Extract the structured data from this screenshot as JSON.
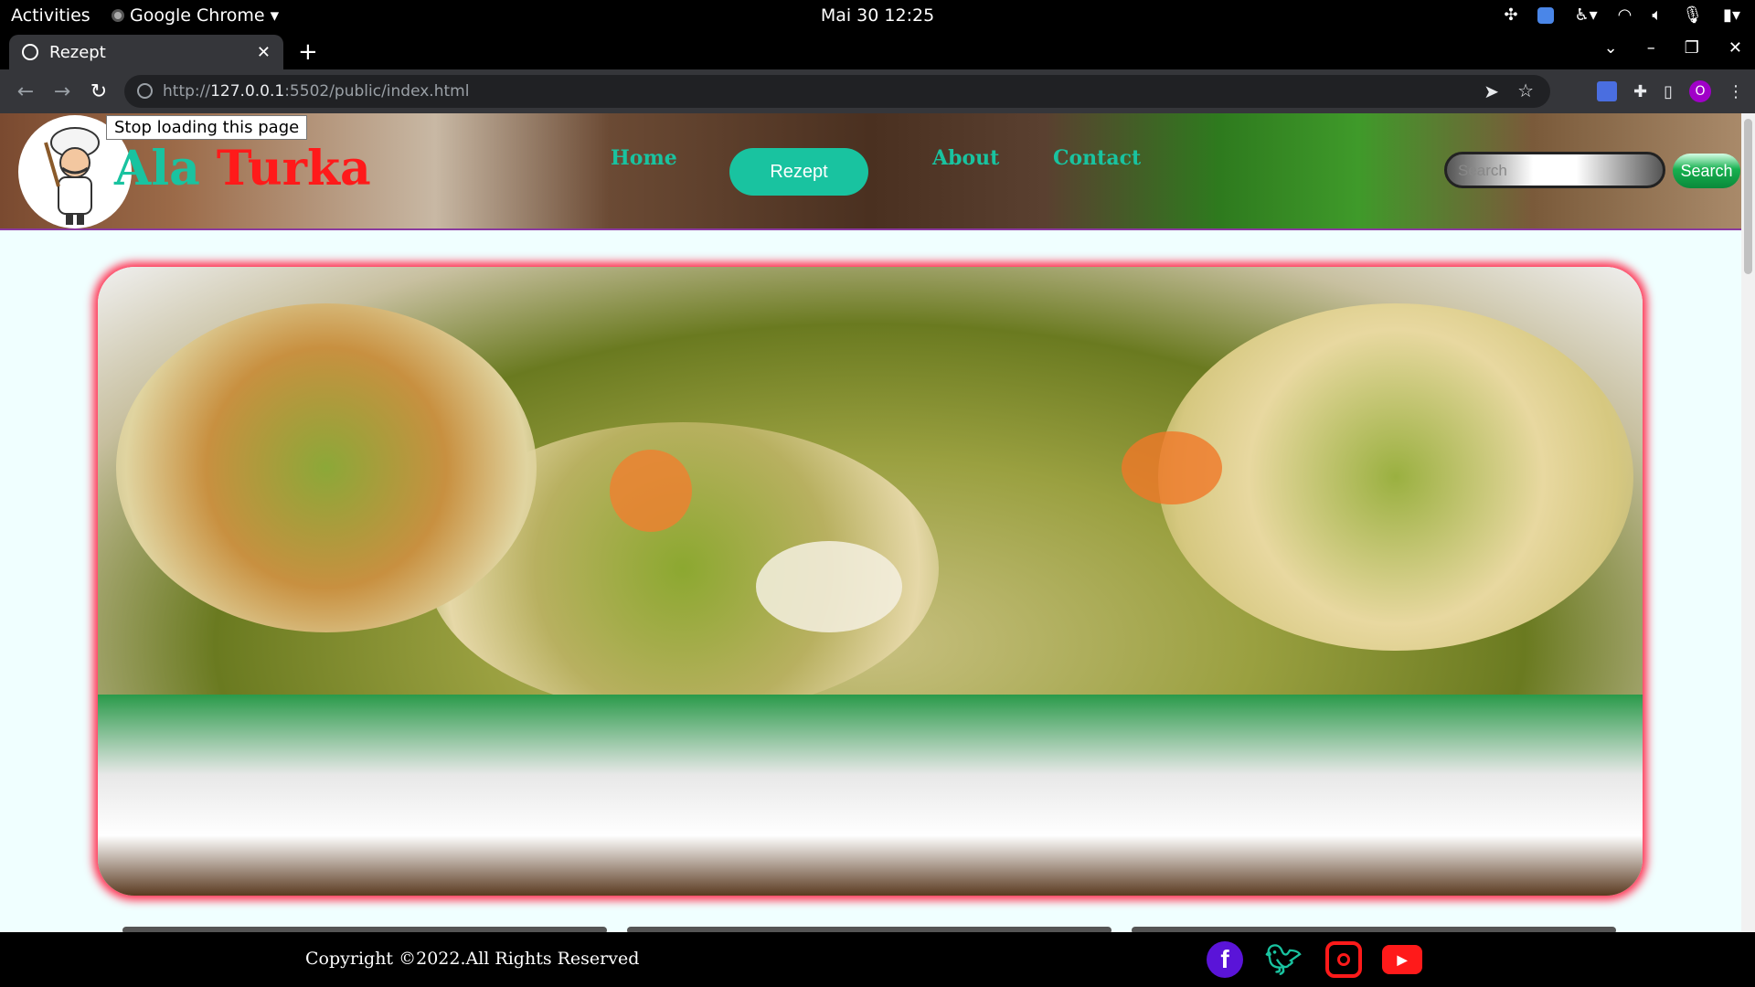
{
  "system": {
    "activities": "Activities",
    "app_name": "Google Chrome",
    "clock": "Mai 30  12:25"
  },
  "browser": {
    "tab_title": "Rezept",
    "url_scheme": "http://",
    "url_host": "127.0.0.1",
    "url_rest": ":5502/public/index.html",
    "profile_initial": "O",
    "tooltip": "Stop loading this page"
  },
  "site": {
    "brand_part1": "Ala",
    "brand_part2": "Turka",
    "nav": [
      "Home",
      "Rezept",
      "About",
      "Contact"
    ],
    "active_nav": "Rezept",
    "search_placeholder": "Search",
    "search_button": "Search",
    "footer_text": "Copyright ©2022.All Rights Reserved",
    "social_icons": [
      "facebook-icon",
      "twitter-icon",
      "instagram-icon",
      "youtube-icon"
    ]
  },
  "colors": {
    "accent": "#19c3a0",
    "brand_red": "#ff1a1a",
    "page_bg": "#f0ffff",
    "footer_bg": "#000000"
  }
}
